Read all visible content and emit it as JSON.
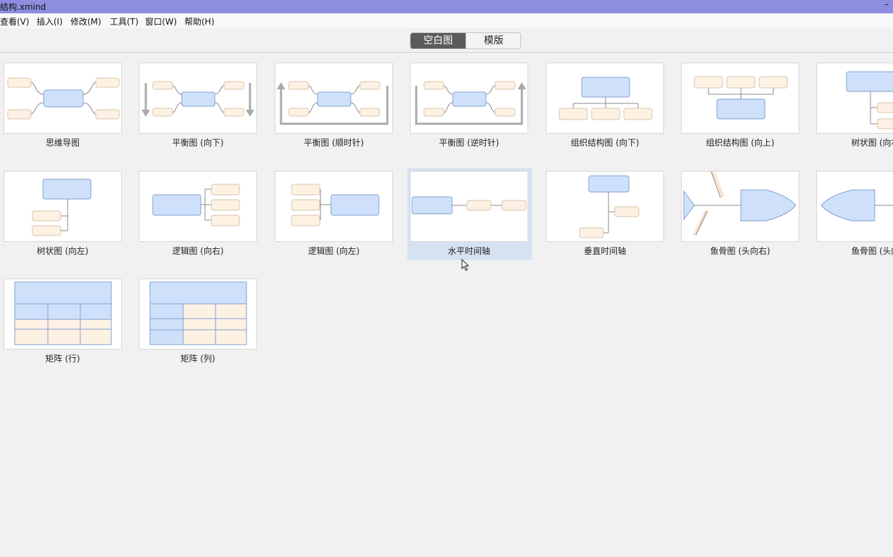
{
  "window": {
    "title": "结构.xmind",
    "minimize_glyph": "–"
  },
  "menu": [
    {
      "label": "查看(V)"
    },
    {
      "label": "插入(I)"
    },
    {
      "label": "修改(M)"
    },
    {
      "label": "工具(T)"
    },
    {
      "label": "窗口(W)"
    },
    {
      "label": "帮助(H)"
    }
  ],
  "tabs": [
    {
      "label": "空白图",
      "active": true
    },
    {
      "label": "模版",
      "active": false
    }
  ],
  "structures": [
    {
      "label": "思维导图",
      "icon": "mind-map-icon"
    },
    {
      "label": "平衡图 (向下)",
      "icon": "balance-map-down-icon"
    },
    {
      "label": "平衡图 (顺时针)",
      "icon": "balance-map-clockwise-icon"
    },
    {
      "label": "平衡图 (逆时针)",
      "icon": "balance-map-anticlockwise-icon"
    },
    {
      "label": "组织结构图 (向下)",
      "icon": "org-chart-down-icon"
    },
    {
      "label": "组织结构图 (向上)",
      "icon": "org-chart-up-icon"
    },
    {
      "label": "树状图 (向右",
      "icon": "tree-chart-right-icon"
    },
    {
      "label": "树状图 (向左)",
      "icon": "tree-chart-left-icon"
    },
    {
      "label": "逻辑图 (向右)",
      "icon": "logic-chart-right-icon"
    },
    {
      "label": "逻辑图 (向左)",
      "icon": "logic-chart-left-icon"
    },
    {
      "label": "水平时间轴",
      "icon": "horizontal-timeline-icon",
      "selected": true
    },
    {
      "label": "垂直时间轴",
      "icon": "vertical-timeline-icon"
    },
    {
      "label": "鱼骨图 (头向右)",
      "icon": "fishbone-right-icon"
    },
    {
      "label": "鱼骨图 (头向",
      "icon": "fishbone-left-icon"
    },
    {
      "label": "矩阵 (行)",
      "icon": "matrix-rows-icon"
    },
    {
      "label": "矩阵 (列)",
      "icon": "matrix-columns-icon"
    }
  ],
  "colors": {
    "titlebar": "#8d8edf",
    "central_topic_fill": "#cfe1fa",
    "central_topic_stroke": "#7f9fcf",
    "subtopic_fill": "#fdf1e4",
    "subtopic_stroke": "#d9c4ad",
    "selected_highlight": "#d5e2f2"
  }
}
